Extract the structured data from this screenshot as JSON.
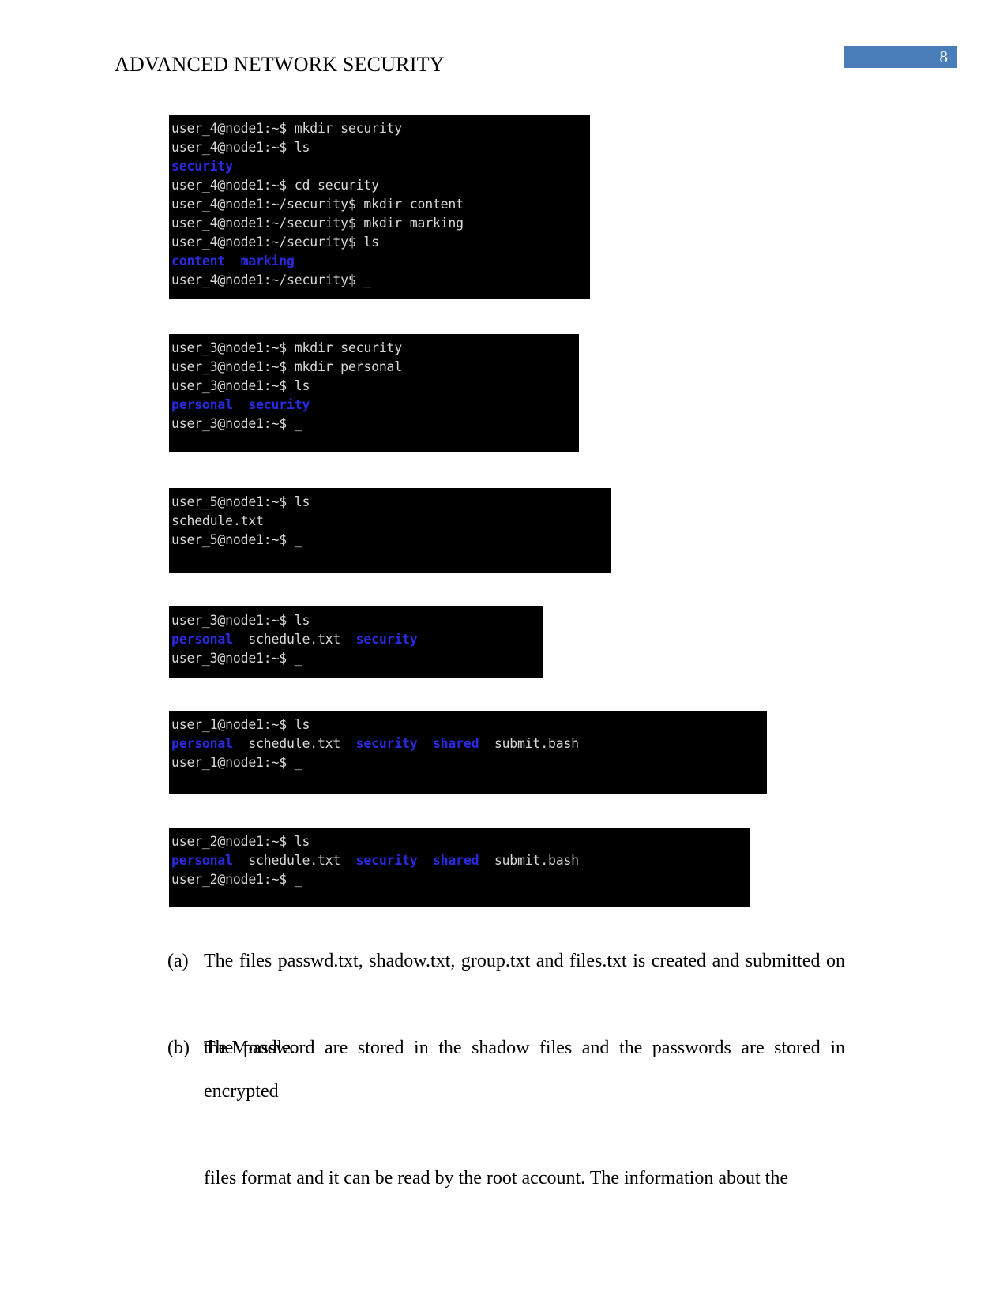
{
  "header": {
    "title": "ADVANCED NETWORK SECURITY",
    "page_number": "8",
    "page_number_bg": "#4a7ebb"
  },
  "terminals": [
    {
      "id": "terminal-1",
      "user": "user_4",
      "lines": [
        {
          "segments": [
            {
              "text": "user_4@node1:~$ mkdir security",
              "kind": "plain"
            }
          ]
        },
        {
          "segments": [
            {
              "text": "user_4@node1:~$ ls",
              "kind": "plain"
            }
          ]
        },
        {
          "segments": [
            {
              "text": "security",
              "kind": "dir"
            }
          ]
        },
        {
          "segments": [
            {
              "text": "user_4@node1:~$ cd security",
              "kind": "plain"
            }
          ]
        },
        {
          "segments": [
            {
              "text": "user_4@node1:~/security$ mkdir content",
              "kind": "plain"
            }
          ]
        },
        {
          "segments": [
            {
              "text": "user_4@node1:~/security$ mkdir marking",
              "kind": "plain"
            }
          ]
        },
        {
          "segments": [
            {
              "text": "user_4@node1:~/security$ ls",
              "kind": "plain"
            }
          ]
        },
        {
          "segments": [
            {
              "text": "content",
              "kind": "dir"
            },
            {
              "text": "  ",
              "kind": "plain"
            },
            {
              "text": "marking",
              "kind": "dir"
            }
          ]
        },
        {
          "segments": [
            {
              "text": "user_4@node1:~/security$ ",
              "kind": "plain"
            },
            {
              "text": "_",
              "kind": "cursor"
            }
          ]
        }
      ]
    },
    {
      "id": "terminal-2",
      "user": "user_3",
      "lines": [
        {
          "segments": [
            {
              "text": "user_3@node1:~$ mkdir security",
              "kind": "plain"
            }
          ]
        },
        {
          "segments": [
            {
              "text": "user_3@node1:~$ mkdir personal",
              "kind": "plain"
            }
          ]
        },
        {
          "segments": [
            {
              "text": "user_3@node1:~$ ls",
              "kind": "plain"
            }
          ]
        },
        {
          "segments": [
            {
              "text": "personal",
              "kind": "dir"
            },
            {
              "text": "  ",
              "kind": "plain"
            },
            {
              "text": "security",
              "kind": "dir"
            }
          ]
        },
        {
          "segments": [
            {
              "text": "user_3@node1:~$ ",
              "kind": "plain"
            },
            {
              "text": "_",
              "kind": "cursor"
            }
          ]
        }
      ]
    },
    {
      "id": "terminal-3",
      "user": "user_5",
      "lines": [
        {
          "segments": [
            {
              "text": "user_5@node1:~$ ls",
              "kind": "plain"
            }
          ]
        },
        {
          "segments": [
            {
              "text": "schedule.txt",
              "kind": "plain"
            }
          ]
        },
        {
          "segments": [
            {
              "text": "user_5@node1:~$ ",
              "kind": "plain"
            },
            {
              "text": "_",
              "kind": "cursor"
            }
          ]
        }
      ]
    },
    {
      "id": "terminal-4",
      "user": "user_3",
      "lines": [
        {
          "segments": [
            {
              "text": "user_3@node1:~$ ls",
              "kind": "plain"
            }
          ]
        },
        {
          "segments": [
            {
              "text": "personal",
              "kind": "dir"
            },
            {
              "text": "  schedule.txt  ",
              "kind": "plain"
            },
            {
              "text": "security",
              "kind": "dir"
            }
          ]
        },
        {
          "segments": [
            {
              "text": "user_3@node1:~$ ",
              "kind": "plain"
            },
            {
              "text": "_",
              "kind": "cursor"
            }
          ]
        }
      ]
    },
    {
      "id": "terminal-5",
      "user": "user_1",
      "lines": [
        {
          "segments": [
            {
              "text": "user_1@node1:~$ ls",
              "kind": "plain"
            }
          ]
        },
        {
          "segments": [
            {
              "text": "personal",
              "kind": "dir"
            },
            {
              "text": "  schedule.txt  ",
              "kind": "plain"
            },
            {
              "text": "security",
              "kind": "dir"
            },
            {
              "text": "  ",
              "kind": "plain"
            },
            {
              "text": "shared",
              "kind": "dir"
            },
            {
              "text": "  submit.bash",
              "kind": "plain"
            }
          ]
        },
        {
          "segments": [
            {
              "text": "user_1@node1:~$ ",
              "kind": "plain"
            },
            {
              "text": "_",
              "kind": "cursor"
            }
          ]
        }
      ]
    },
    {
      "id": "terminal-6",
      "user": "user_2",
      "lines": [
        {
          "segments": [
            {
              "text": "user_2@node1:~$ ls",
              "kind": "plain"
            }
          ]
        },
        {
          "segments": [
            {
              "text": "personal",
              "kind": "dir"
            },
            {
              "text": "  schedule.txt  ",
              "kind": "plain"
            },
            {
              "text": "security",
              "kind": "dir"
            },
            {
              "text": "  ",
              "kind": "plain"
            },
            {
              "text": "shared",
              "kind": "dir"
            },
            {
              "text": "  submit.bash",
              "kind": "plain"
            }
          ]
        },
        {
          "segments": [
            {
              "text": "user_2@node1:~$ ",
              "kind": "plain"
            },
            {
              "text": "_",
              "kind": "cursor"
            }
          ]
        }
      ]
    }
  ],
  "paragraphs": [
    {
      "marker": "(a)",
      "lines": [
        "The files passwd.txt, shadow.txt, group.txt and files.txt is created and submitted on",
        "the Moodle."
      ]
    },
    {
      "marker": "(b)",
      "lines": [
        "The password are stored in the shadow files and the passwords are stored in encrypted",
        "files format and it can be read by the root account. The information about the"
      ]
    }
  ]
}
